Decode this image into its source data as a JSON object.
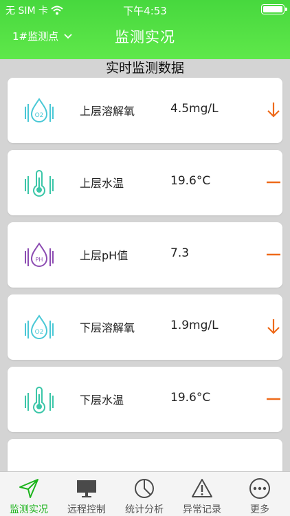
{
  "status": {
    "carrier": "无 SIM 卡",
    "time": "下午4:53"
  },
  "nav": {
    "point": "1#监测点",
    "title": "监测实况"
  },
  "section_title": "实时监测数据",
  "colors": {
    "header": "#47d83e",
    "oxygen_icon": "#49c8d6",
    "temp_icon": "#3bc6a8",
    "ph_icon": "#8c4bb2",
    "trend": "#ee6a1a",
    "active_tab": "#1bb31b"
  },
  "items": [
    {
      "name": "上层溶解氧",
      "value": "4.5mg/L",
      "icon": "oxygen-drop-icon",
      "trend": "down"
    },
    {
      "name": "上层水温",
      "value": "19.6°C",
      "icon": "thermometer-icon",
      "trend": "flat"
    },
    {
      "name": "上层pH值",
      "value": "7.3",
      "icon": "ph-drop-icon",
      "trend": "flat"
    },
    {
      "name": "下层溶解氧",
      "value": "1.9mg/L",
      "icon": "oxygen-drop-icon",
      "trend": "down"
    },
    {
      "name": "下层水温",
      "value": "19.6°C",
      "icon": "thermometer-icon",
      "trend": "flat"
    }
  ],
  "tabs": [
    {
      "label": "监测实况",
      "icon": "paper-plane-icon",
      "active": true
    },
    {
      "label": "远程控制",
      "icon": "monitor-icon",
      "active": false
    },
    {
      "label": "统计分析",
      "icon": "pie-chart-icon",
      "active": false
    },
    {
      "label": "异常记录",
      "icon": "warning-icon",
      "active": false
    },
    {
      "label": "更多",
      "icon": "more-icon",
      "active": false
    }
  ]
}
